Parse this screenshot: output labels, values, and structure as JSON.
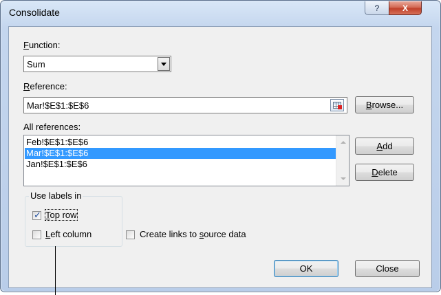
{
  "window": {
    "title": "Consolidate",
    "help_glyph": "?",
    "close_glyph": "X"
  },
  "function": {
    "label_first": "F",
    "label_rest": "unction:",
    "value": "Sum"
  },
  "reference": {
    "label_first": "R",
    "label_rest": "eference:",
    "value": "Mar!$E$1:$E$6"
  },
  "all_references": {
    "label": "All references:",
    "items": [
      "Feb!$E$1:$E$6",
      "Mar!$E$1:$E$6",
      "Jan!$E$1:$E$6"
    ],
    "selected_index": 1
  },
  "buttons": {
    "browse_first": "B",
    "browse_rest": "rowse...",
    "add_first": "A",
    "add_rest": "dd",
    "delete_first": "D",
    "delete_rest": "elete",
    "ok": "OK",
    "close": "Close"
  },
  "use_labels": {
    "title": "Use labels in",
    "top_row_first": "T",
    "top_row_rest": "op row",
    "top_row_checked": true,
    "left_column_first": "L",
    "left_column_rest": "eft column",
    "left_column_checked": false
  },
  "create_links": {
    "pre": "Create links to ",
    "underlined": "s",
    "post": "ource data",
    "checked": false
  },
  "colors": {
    "selection": "#3399ff",
    "title_bar": "#c4d6ee",
    "close_button": "#c0402a"
  }
}
